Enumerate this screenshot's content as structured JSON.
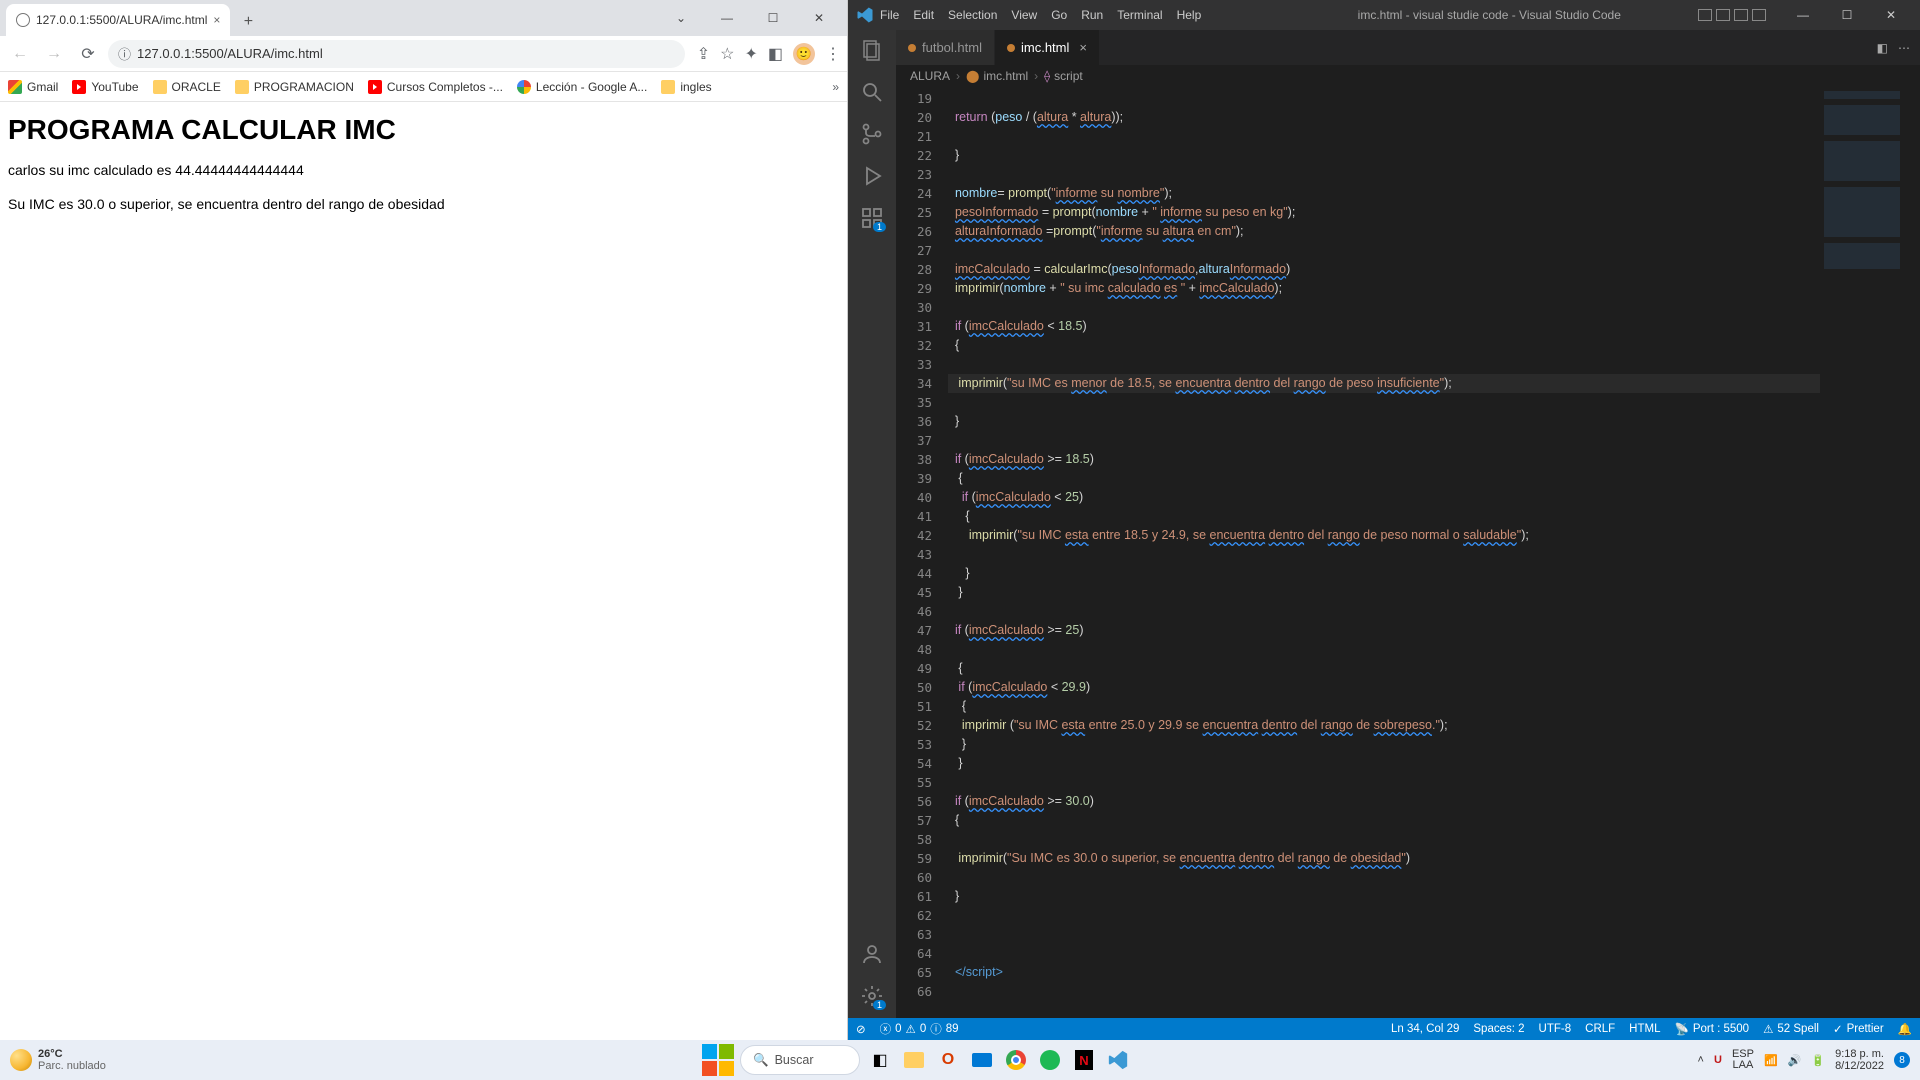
{
  "chrome": {
    "tab_title": "127.0.0.1:5500/ALURA/imc.html",
    "url": "127.0.0.1:5500/ALURA/imc.html",
    "bookmarks": [
      "Gmail",
      "YouTube",
      "ORACLE",
      "PROGRAMACION",
      "Cursos Completos -...",
      "Lección - Google A...",
      "ingles"
    ],
    "page": {
      "heading": "PROGRAMA CALCULAR IMC",
      "line1": "carlos su imc calculado es 44.44444444444444",
      "line2": "Su IMC es 30.0 o superior, se encuentra dentro del rango de obesidad"
    }
  },
  "vscode": {
    "menu": [
      "File",
      "Edit",
      "Selection",
      "View",
      "Go",
      "Run",
      "Terminal",
      "Help"
    ],
    "title": "imc.html - visual studie code - Visual Studio Code",
    "tabs": [
      {
        "name": "futbol.html",
        "active": false,
        "modified": true
      },
      {
        "name": "imc.html",
        "active": true,
        "modified": true
      }
    ],
    "breadcrumb": [
      "ALURA",
      "imc.html",
      "script"
    ],
    "first_line": 19,
    "lines": [
      "",
      "  <kw>return</kw> (<var>peso</var> / (<sq>altura</sq> * <sq>altura</sq>));",
      "",
      "  }",
      "",
      "  <var>nombre</var>= <fn>prompt</fn>(<str>\"</str><sq>informe</sq><str> su </str><sq>nombre</sq><str>\"</str>);",
      "  <sq>pesoInformado</sq> = <fn>prompt</fn>(<var>nombre</var> + <str>\" </str><sq>informe</sq><str> su peso en kg\"</str>);",
      "  <sq>alturaInformado</sq> =<fn>prompt</fn>(<str>\"</str><sq>informe</sq><str> su </str><sq>altura</sq><str> en cm\"</str>);",
      "",
      "  <sq>imcCalculado</sq> = <fn>calcularImc</fn>(<var>peso</var><sq>Informado</sq>,<var>altura</var><sq>Informado</sq>)",
      "  <fn>imprimir</fn>(<var>nombre</var> + <str>\" su imc </str><sq>calculado</sq><str> </str><sq>es</sq><str> \"</str> + <sq>imcCalculado</sq>);",
      "",
      "  <kw>if</kw> (<sq>imcCalculado</sq> &lt; <num>18.5</num>)",
      "  {",
      "",
      "   <fn>imprimir</fn>(<str>\"su IMC es </str><sq>menor</sq><str> de 18.5, se </str><sq>encuentra</sq><str> </str><sq>dentro</sq><str> del </str><sq>rango</sq><str> de peso </str><sq>insuficiente</sq><str>\"</str>);",
      "",
      "  }",
      "",
      "  <kw>if</kw> (<sq>imcCalculado</sq> &gt;= <num>18.5</num>)",
      "   {",
      "    <kw>if</kw> (<sq>imcCalculado</sq> &lt; <num>25</num>)",
      "     {",
      "      <fn>imprimir</fn>(<str>\"su IMC </str><sq>esta</sq><str> entre 18.5 y 24.9, se </str><sq>encuentra</sq><str> </str><sq>dentro</sq><str> del </str><sq>rango</sq><str> de peso normal o </str><sq>saludable</sq><str>\"</str>);",
      "",
      "     }",
      "   }",
      "",
      "  <kw>if</kw> (<sq>imcCalculado</sq> &gt;= <num>25</num>)",
      "",
      "   {",
      "   <kw>if</kw> (<sq>imcCalculado</sq> &lt; <num>29.9</num>)",
      "    {",
      "    <fn>imprimir</fn> (<str>\"su IMC </str><sq>esta</sq><str> entre 25.0 y 29.9 se </str><sq>encuentra</sq><str> </str><sq>dentro</sq><str> del </str><sq>rango</sq><str> de </str><sq>sobrepeso</sq><str>.\"</str>);",
      "    }",
      "   }",
      "",
      "  <kw>if</kw> (<sq>imcCalculado</sq> &gt;= <num>30.0</num>)",
      "  {",
      "",
      "   <fn>imprimir</fn>(<str>\"Su IMC es 30.0 o superior, se </str><sq>encuentra</sq><str> </str><sq>dentro</sq><str> del </str><sq>rango</sq><str> de </str><sq>obesidad</sq><str>\"</str>)",
      "",
      "  }",
      "",
      "",
      "",
      "  <tag>&lt;/</tag><tag>script</tag><tag>&gt;</tag>",
      ""
    ],
    "status": {
      "errors": "0",
      "warnings": "0",
      "info": "89",
      "lncol": "Ln 34, Col 29",
      "spaces": "Spaces: 2",
      "encoding": "UTF-8",
      "eol": "CRLF",
      "lang": "HTML",
      "port": "Port : 5500",
      "spell": "52 Spell",
      "formatter": "Prettier"
    }
  },
  "taskbar": {
    "weather_temp": "26°C",
    "weather_desc": "Parc. nublado",
    "search_placeholder": "Buscar",
    "lang_top": "ESP",
    "lang_bot": "LAA",
    "time": "9:18 p. m.",
    "date": "8/12/2022"
  }
}
